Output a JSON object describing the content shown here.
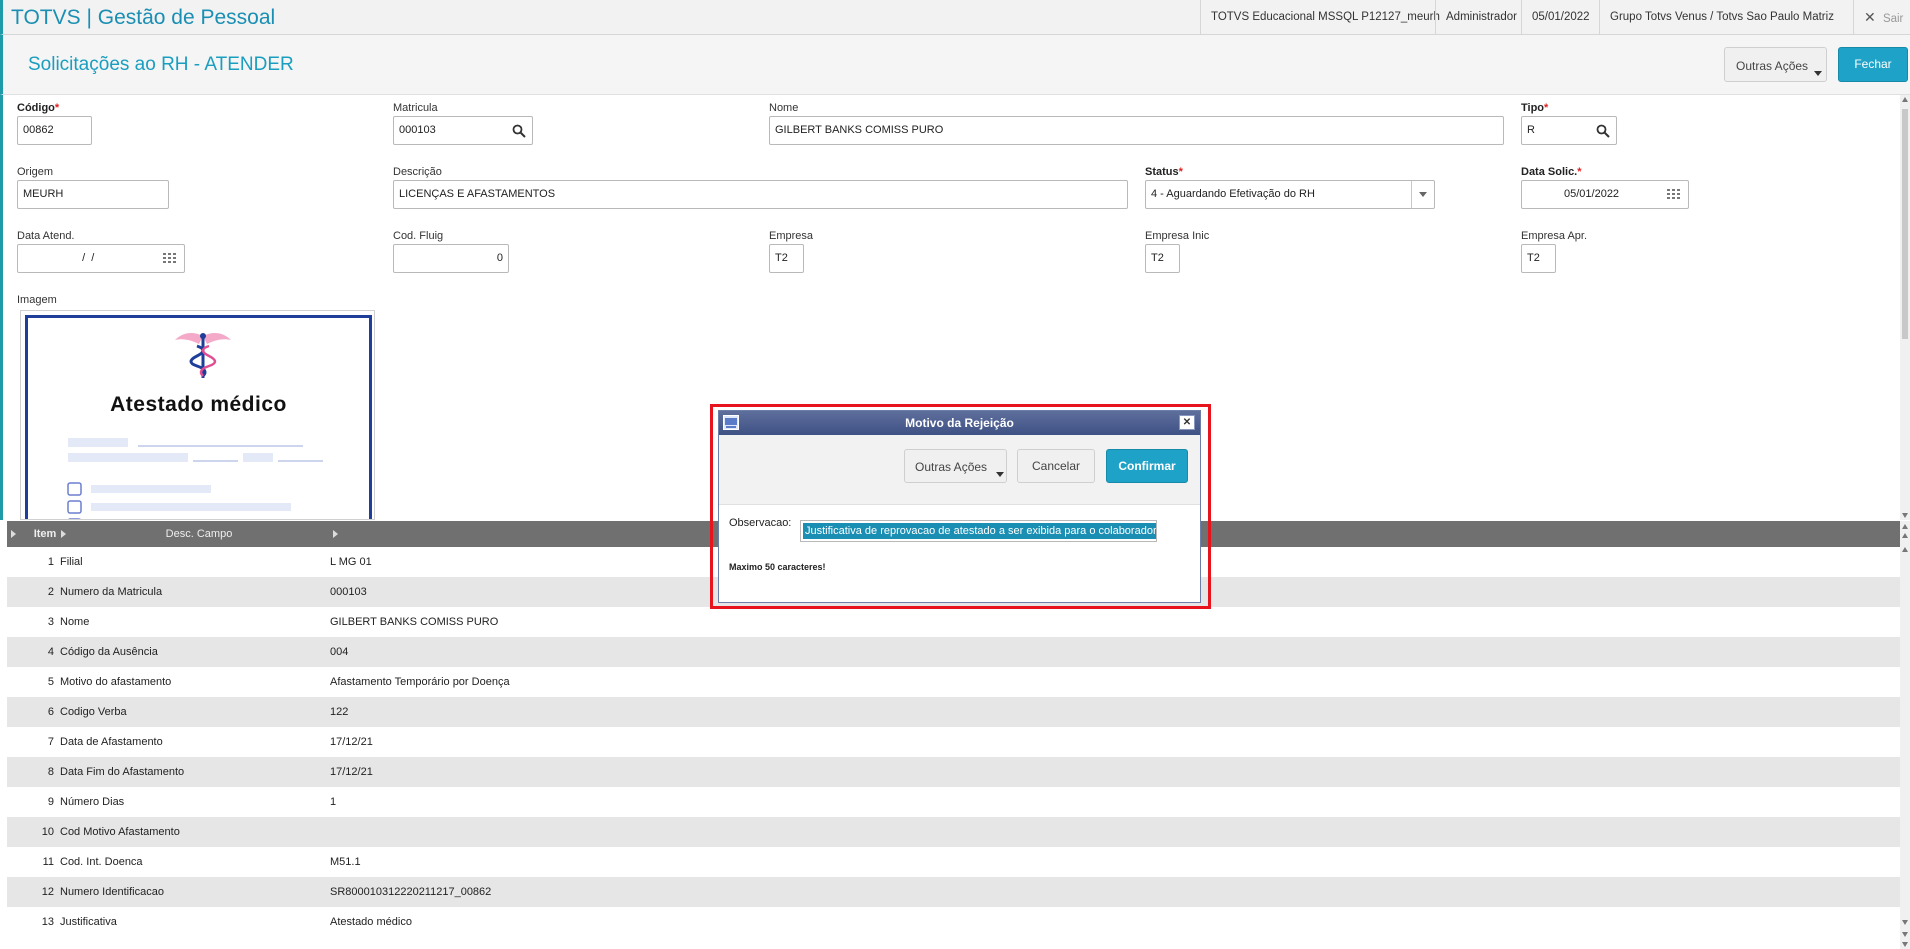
{
  "topbar": {
    "app_title": "TOTVS | Gestão de Pessoal",
    "environment": "TOTVS Educacional MSSQL P12127_meurh",
    "user": "Administrador",
    "date": "05/01/2022",
    "company": "Grupo Totvs Venus / Totvs Sao Paulo Matriz",
    "exit_label": "Sair"
  },
  "header": {
    "title": "Solicitações ao RH - ATENDER",
    "other_actions_label": "Outras Ações",
    "close_label": "Fechar"
  },
  "form": {
    "codigo": {
      "label": "Código",
      "value": "00862"
    },
    "matricula": {
      "label": "Matricula",
      "value": "000103"
    },
    "nome": {
      "label": "Nome",
      "value": "GILBERT BANKS COMISS PURO"
    },
    "tipo": {
      "label": "Tipo",
      "value": "R"
    },
    "origem": {
      "label": "Origem",
      "value": "MEURH"
    },
    "descricao": {
      "label": "Descrição",
      "value": "LICENÇAS E AFASTAMENTOS"
    },
    "status": {
      "label": "Status",
      "value": "4 - Aguardando Efetivação do RH"
    },
    "data_solic": {
      "label": "Data Solic.",
      "value": "05/01/2022"
    },
    "data_atend": {
      "label": "Data Atend.",
      "value": "  /  /"
    },
    "cod_fluig": {
      "label": "Cod. Fluig",
      "value": "0"
    },
    "empresa": {
      "label": "Empresa",
      "value": "T2"
    },
    "empresa_inic": {
      "label": "Empresa Inic",
      "value": "T2"
    },
    "empresa_apr": {
      "label": "Empresa Apr.",
      "value": "T2"
    },
    "imagem": {
      "label": "Imagem",
      "doc_title": "Atestado médico"
    }
  },
  "grid": {
    "columns": [
      "Item",
      "Desc. Campo",
      ""
    ],
    "rows": [
      {
        "num": "1",
        "field": "Filial",
        "value": "L MG 01"
      },
      {
        "num": "2",
        "field": "Numero da Matricula",
        "value": "000103"
      },
      {
        "num": "3",
        "field": "Nome",
        "value": "GILBERT BANKS COMISS PURO"
      },
      {
        "num": "4",
        "field": "Código da Ausência",
        "value": "004"
      },
      {
        "num": "5",
        "field": "Motivo do afastamento",
        "value": "Afastamento Temporário por Doença"
      },
      {
        "num": "6",
        "field": "Codigo Verba",
        "value": "122"
      },
      {
        "num": "7",
        "field": "Data de Afastamento",
        "value": "17/12/21"
      },
      {
        "num": "8",
        "field": "Data Fim do Afastamento",
        "value": "17/12/21"
      },
      {
        "num": "9",
        "field": "Número Dias",
        "value": "1"
      },
      {
        "num": "10",
        "field": "Cod Motivo Afastamento",
        "value": ""
      },
      {
        "num": "11",
        "field": "Cod. Int. Doenca",
        "value": "M51.1"
      },
      {
        "num": "12",
        "field": "Numero Identificacao",
        "value": "SR800010312220211217_00862"
      },
      {
        "num": "13",
        "field": "Justificativa",
        "value": "Atestado médico"
      }
    ]
  },
  "modal": {
    "title": "Motivo da Rejeição",
    "other_actions_label": "Outras Ações",
    "cancel_label": "Cancelar",
    "confirm_label": "Confirmar",
    "obs_label": "Observacao:",
    "obs_value": "Justificativa de reprovacao de atestado a ser exibida para o colaborador",
    "max_note": "Maximo 50 caracteres!"
  },
  "colors": {
    "accent": "#1fa2c7",
    "highlight": "#e8141d",
    "modal_header": "#4a5b8c"
  }
}
